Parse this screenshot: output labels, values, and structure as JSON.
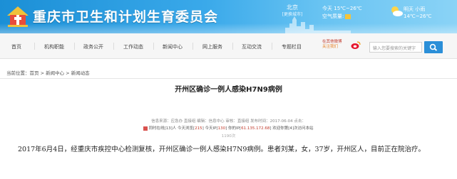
{
  "header": {
    "site_title": "重庆市卫生和计划生育委员会",
    "city": "北京",
    "city_sub": "[更换城市]",
    "today_label": "今天",
    "today_temp": "15℃~26℃",
    "air_label": "空气质量:",
    "tomorrow_label": "明天",
    "tomorrow_weather": "小雨",
    "tomorrow_temp": "14℃~26℃",
    "brand_color": "#1b8fd6"
  },
  "nav": {
    "items": [
      "首页",
      "机构职能",
      "政务公开",
      "工作动态",
      "新闻中心",
      "网上服务",
      "互动交流",
      "专题栏目"
    ],
    "weibo_line1": "在其他微博",
    "weibo_line2": "关注我们",
    "search_placeholder": "输入您要搜索的关键字",
    "search_icon": "search-icon"
  },
  "breadcrumb": {
    "text": "当前位置：首页 > 新闻中心 > 新闻动态"
  },
  "article": {
    "title": "开州区确诊一例人感染H7N9病例",
    "meta_line1": "信息来源：应急办  直接组  编辑：信息中心  审核：直接组  发布时间：2017-06-04  点击：",
    "meta_prefix": "同时在线[13]人  今天浏览[",
    "today_views": "215",
    "meta_mid": "]  今天IP[",
    "today_ip": "130",
    "meta_ip_label": "]  你的IP[",
    "your_ip": "61.135.172.68",
    "meta_suffix": "]  欢迎你第[4]次访问本站",
    "visits": "1190次",
    "body": "2017年6月4日，经重庆市疾控中心检测复核，开州区确诊一例人感染H7N9病例。患者刘某，女，37岁，开州区人，目前正在院治疗。"
  }
}
